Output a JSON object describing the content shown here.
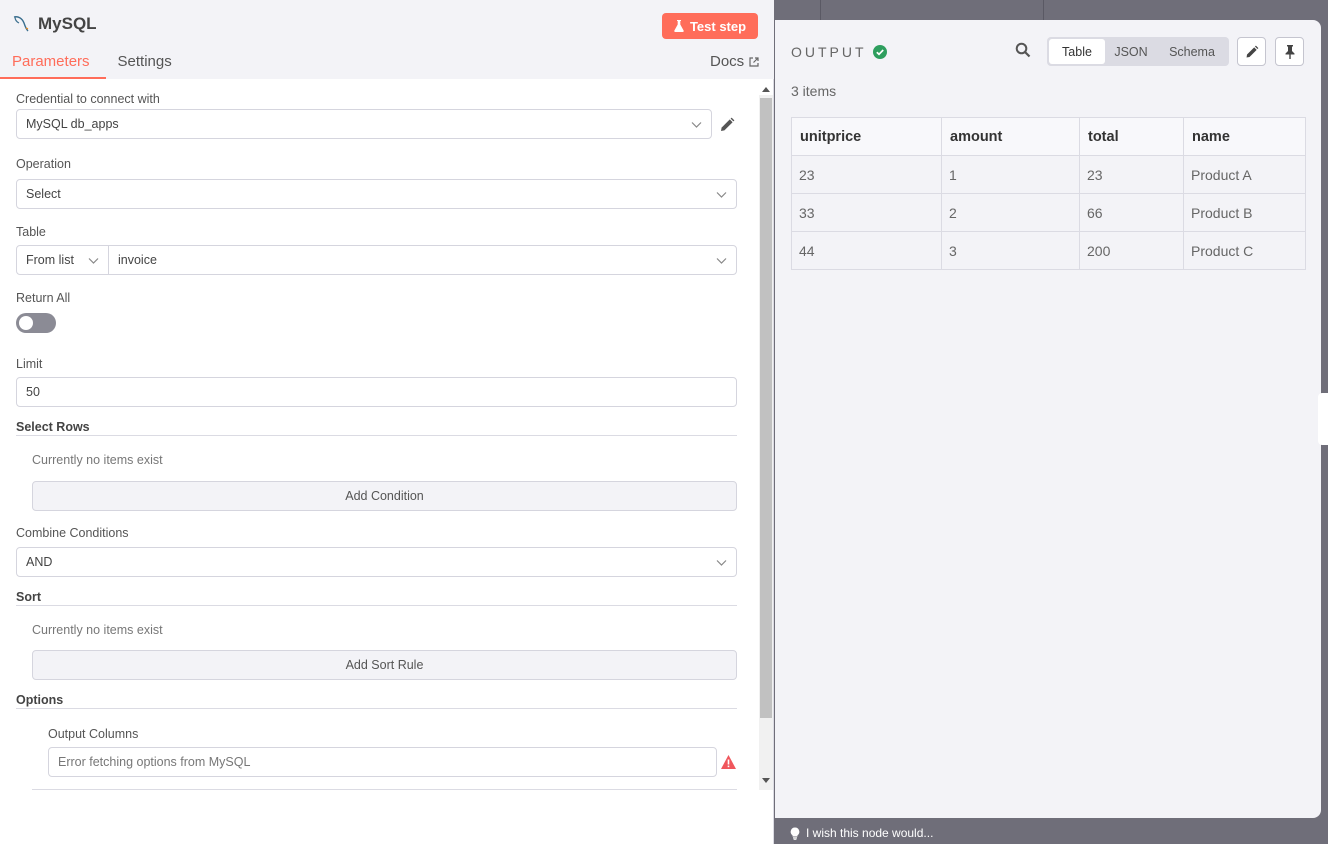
{
  "node": {
    "title": "MySQL",
    "test_step_label": "Test step"
  },
  "tabs": [
    {
      "label": "Parameters"
    },
    {
      "label": "Settings"
    }
  ],
  "docs_label": "Docs",
  "params": {
    "credential": {
      "label": "Credential to connect with",
      "value": "MySQL db_apps"
    },
    "operation": {
      "label": "Operation",
      "value": "Select"
    },
    "table": {
      "label": "Table",
      "mode": "From list",
      "value": "invoice"
    },
    "return_all": {
      "label": "Return All",
      "on": false
    },
    "limit": {
      "label": "Limit",
      "value": "50"
    },
    "select_rows": {
      "label": "Select Rows",
      "empty": "Currently no items exist",
      "button": "Add Condition"
    },
    "combine": {
      "label": "Combine Conditions",
      "value": "AND"
    },
    "sort": {
      "label": "Sort",
      "empty": "Currently no items exist",
      "button": "Add Sort Rule"
    },
    "options": {
      "label": "Options"
    },
    "output_columns": {
      "label": "Output Columns",
      "placeholder": "Error fetching options from MySQL"
    }
  },
  "output": {
    "label": "OUTPUT",
    "views": [
      "Table",
      "JSON",
      "Schema"
    ],
    "active_view": "Table",
    "items_count": "3 items",
    "columns": [
      "unitprice",
      "amount",
      "total",
      "name"
    ],
    "rows": [
      [
        "23",
        "1",
        "23",
        "Product A"
      ],
      [
        "33",
        "2",
        "66",
        "Product B"
      ],
      [
        "44",
        "3",
        "200",
        "Product C"
      ]
    ]
  },
  "footer": {
    "wish_text": "I wish this node would..."
  },
  "colors": {
    "accent": "#ff6d5a",
    "success": "#2e9e5e"
  }
}
